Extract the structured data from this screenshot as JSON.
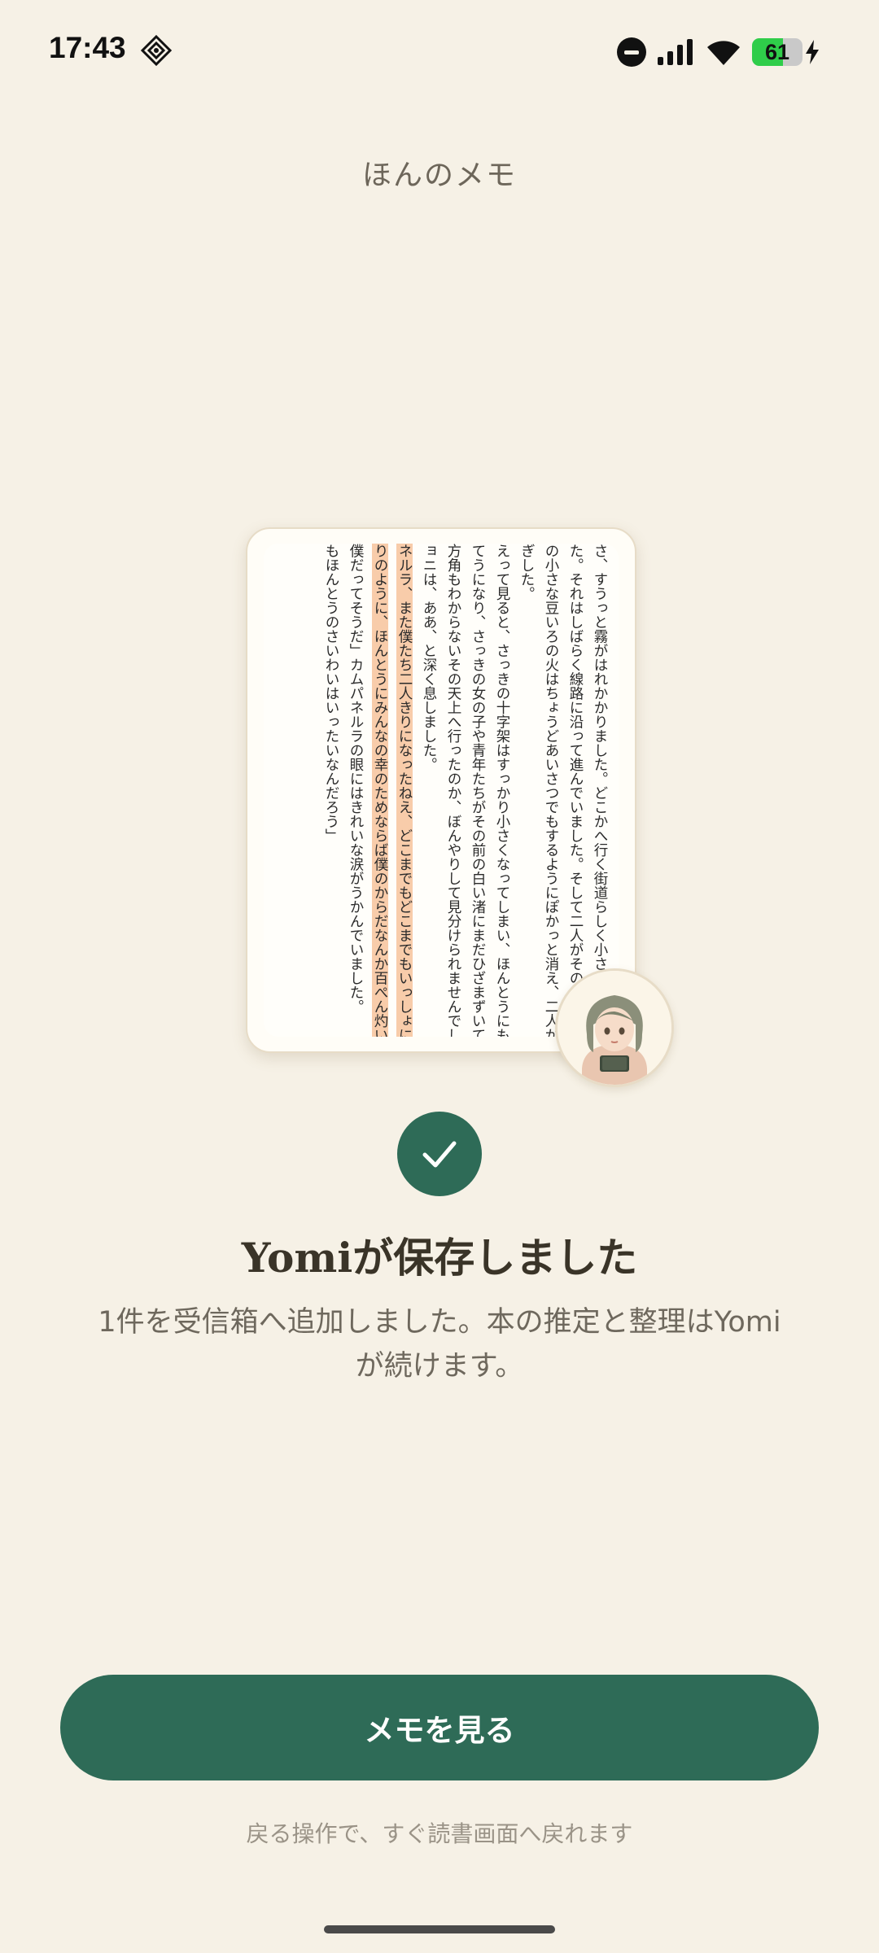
{
  "status_bar": {
    "time": "17:43",
    "battery_level": "61",
    "battery_fraction": 0.61,
    "icons": [
      "app-diamond-icon",
      "do-not-disturb-icon",
      "cellular-signal-icon",
      "wifi-icon",
      "battery-icon",
      "charging-bolt-icon"
    ]
  },
  "header": {
    "title": "ほんのメモ"
  },
  "page_preview": {
    "lines": [
      "さ、すうっと霧がはれかかりました。どこかへ行く街道らしく小さな電",
      "た。それはしばらく線路に沿って進んでいました。そして二人がそのあかしの前",
      "の小さな豆いろの火はちょうどあいさつでもするようにぽかっと消え、二人が過",
      "ぎした。",
      "えって見ると、さっきの十字架はすっかり小さくなってしまい、ほんとうにもう",
      "てうになり、さっきの女の子や青年たちがその前の白い渚にまだひざまずいてい",
      "方角もわからないその天上へ行ったのか、ぼんやりして見分けられませんでした",
      "ョニは、ああ、と深く息しました。",
      "ネルラ、また僕たち二人きりになったねえ、どこまでもどこまでもいっしょに行",
      "りのように、ほんとうにみんなの幸のためならば僕のからだなんか百ぺん灼いて",
      "僕だってそうだ」カムパネルラの眼にはきれいな涙がうかんでいました。",
      "もほんとうのさいわいはいったいなんだろう」"
    ],
    "highlighted_line_indices": [
      8,
      9
    ]
  },
  "avatar": {
    "icon": "reading-girl-avatar-icon"
  },
  "confirmation": {
    "icon": "check-icon",
    "title": "Yomiが保存しました",
    "description": "1件を受信箱へ追加しました。本の推定と整理はYomiが続けます。"
  },
  "actions": {
    "primary_label": "メモを見る",
    "hint": "戻る操作で、すぐ読書画面へ戻れます"
  },
  "colors": {
    "background": "#f6f1e6",
    "accent": "#2e6b57",
    "highlight": "#f8ccaa",
    "battery_green": "#2fcd4a"
  }
}
